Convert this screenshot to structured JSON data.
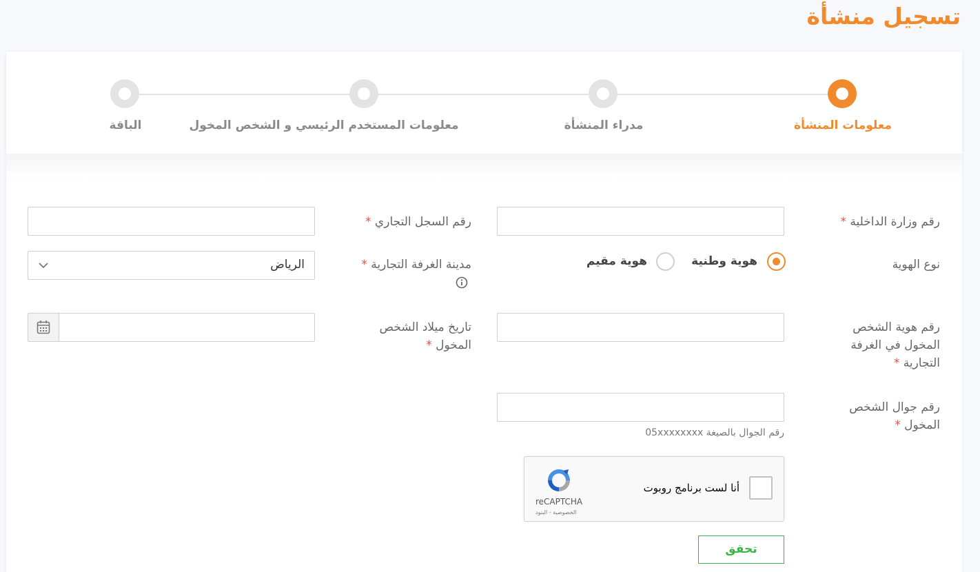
{
  "page": {
    "title": "تسجيل منشأة"
  },
  "steps": [
    {
      "label": "معلومات المنشأة",
      "state": "active"
    },
    {
      "label": "مدراء المنشأة",
      "state": "inactive"
    },
    {
      "label": "معلومات المستخدم الرئيسي و الشخص المخول",
      "state": "inactive"
    },
    {
      "label": "الباقة",
      "state": "inactive"
    }
  ],
  "form": {
    "required_mark": "*",
    "moi_number": {
      "label": "رقم وزارة الداخلية",
      "value": ""
    },
    "cr_number": {
      "label": "رقم السجل التجاري",
      "value": ""
    },
    "id_type": {
      "label": "نوع الهوية",
      "options": [
        {
          "label": "هوية وطنية",
          "checked": true
        },
        {
          "label": "هوية مقيم",
          "checked": false
        }
      ]
    },
    "chamber_city": {
      "label": "مدينة الغرفة التجارية",
      "value": "الرياض"
    },
    "authorized_id": {
      "label_lines": [
        "رقم هوية الشخص",
        "المخول في الغرفة",
        "التجارية"
      ],
      "value": ""
    },
    "authorized_dob": {
      "label_lines": [
        "تاريخ ميلاد الشخص",
        "المخول"
      ],
      "value": ""
    },
    "authorized_mobile": {
      "label_lines": [
        "رقم جوال الشخص",
        "المخول"
      ],
      "value": "",
      "hint": "رقم الجوال بالصيغة 05xxxxxxxx"
    }
  },
  "captcha": {
    "text": "أنا لست برنامج روبوت",
    "brand": "reCAPTCHA",
    "terms": "الخصوصية - البنود"
  },
  "verify_button": {
    "label": "تحقق"
  },
  "colors": {
    "accent": "#f08a2c",
    "verify": "#3cb44a",
    "required": "#d9534f"
  },
  "icons": {
    "info": "info-icon",
    "calendar": "calendar-icon",
    "chevron": "chevron-down-icon",
    "recaptcha": "recaptcha-logo-icon"
  }
}
